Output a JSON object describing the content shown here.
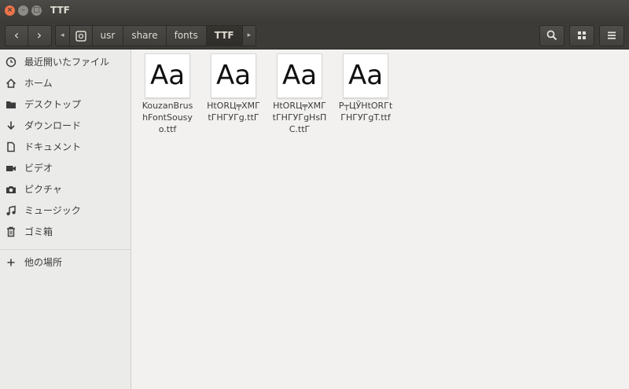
{
  "window": {
    "title": "TTF"
  },
  "toolbar": {
    "back_glyph": "‹",
    "forward_glyph": "›",
    "crumb_left_arrow": "◂",
    "crumb_right_arrow": "▸",
    "breadcrumbs": [
      "usr",
      "share",
      "fonts",
      "TTF"
    ]
  },
  "sidebar": {
    "items": [
      {
        "label": "最近開いたファイル",
        "icon": "clock-icon"
      },
      {
        "label": "ホーム",
        "icon": "home-icon"
      },
      {
        "label": "デスクトップ",
        "icon": "folder-icon"
      },
      {
        "label": "ダウンロード",
        "icon": "download-icon"
      },
      {
        "label": "ドキュメント",
        "icon": "document-icon"
      },
      {
        "label": "ビデオ",
        "icon": "video-icon"
      },
      {
        "label": "ピクチャ",
        "icon": "camera-icon"
      },
      {
        "label": "ミュージック",
        "icon": "music-icon"
      },
      {
        "label": "ゴミ箱",
        "icon": "trash-icon"
      },
      {
        "label": "他の場所",
        "icon": "plus-icon"
      }
    ]
  },
  "files": [
    {
      "preview": "Aa",
      "name": "KouzanBrushFontSousyo.ttf"
    },
    {
      "preview": "Aa",
      "name": "HtORЦ╤XMГtГНГУГg.ttГ"
    },
    {
      "preview": "Aa",
      "name": "HtORЦ╤XMГtГНГУГgHsПС.ttГ"
    },
    {
      "preview": "Aa",
      "name": "Р┬ЦЎНtОRГtГНГУГgT.ttf"
    }
  ]
}
